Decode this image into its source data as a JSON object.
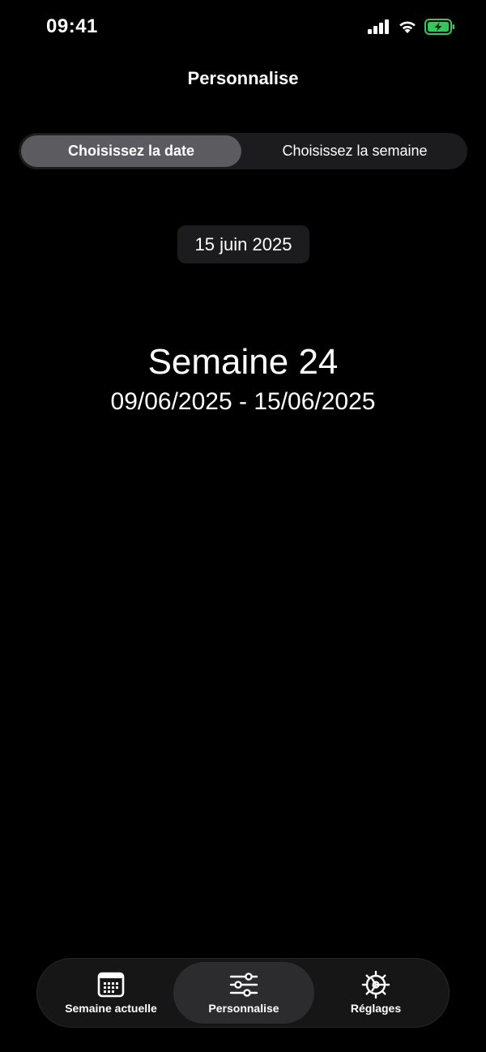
{
  "status_bar": {
    "time": "09:41",
    "icons": [
      "cellular-signal-icon",
      "wifi-icon",
      "battery-charging-icon"
    ],
    "battery_color": "#34c759"
  },
  "header": {
    "title": "Personnalise"
  },
  "segmented_control": {
    "options": [
      "Choisissez la date",
      "Choisissez la semaine"
    ],
    "selected": "Choisissez la date"
  },
  "date_picker": {
    "value": "15 juin 2025"
  },
  "week_info": {
    "title": "Semaine 24",
    "range": "09/06/2025 - 15/06/2025"
  },
  "tab_bar": {
    "items": [
      {
        "label": "Semaine actuelle",
        "icon": "calendar-icon"
      },
      {
        "label": "Personnalise",
        "icon": "sliders-icon"
      },
      {
        "label": "Réglages",
        "icon": "gear-icon"
      }
    ],
    "selected": "Personnalise"
  }
}
